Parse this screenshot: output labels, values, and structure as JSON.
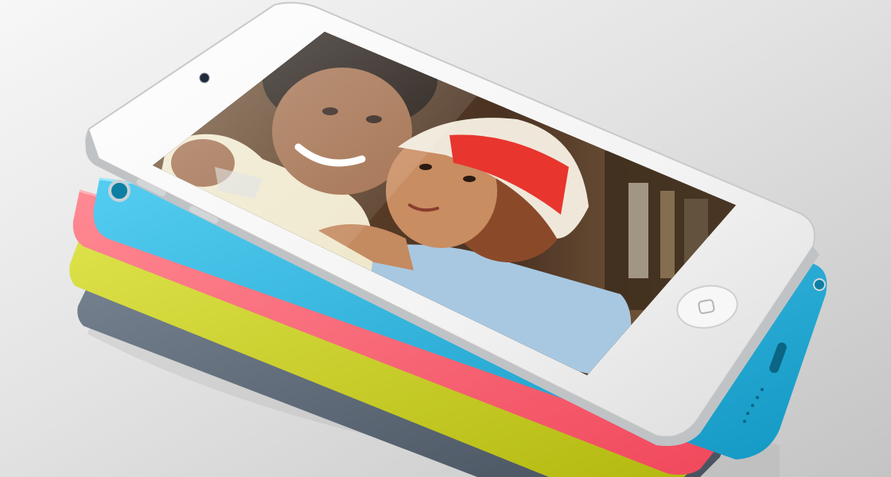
{
  "scene": {
    "background": {
      "light": "#f4f4f4",
      "mid": "#d9d9d9",
      "dark": "#bdbdbd"
    },
    "devices": [
      {
        "name": "slate-ipod",
        "color": "#5b6778",
        "highlight": "#7b8797"
      },
      {
        "name": "yellow-ipod",
        "color": "#c8cc22",
        "highlight": "#dfe352"
      },
      {
        "name": "pink-ipod",
        "color": "#ff5c6c",
        "highlight": "#ff8f99"
      },
      {
        "name": "blue-ipod",
        "color": "#1fb4df",
        "highlight": "#62d3f2"
      },
      {
        "name": "silver-ipod",
        "color": "#f4f4f4",
        "highlight": "#ffffff"
      }
    ],
    "screen_photo": {
      "subject": "couple-selfie",
      "hat_band_color": "#e8352e",
      "hat_color": "#efe9dc",
      "shirt_man": "#f0ead0",
      "shirt_woman": "#a9c9e2",
      "skin_man": "#9c6a4a",
      "skin_woman": "#c78c63",
      "hair": "#2a1c14",
      "hair_woman": "#8a4a2a",
      "backdrop": "#5a3a22"
    },
    "icons": [
      "camera-icon",
      "home-button-icon",
      "lightning-port-icon",
      "speaker-grille-icon"
    ]
  }
}
